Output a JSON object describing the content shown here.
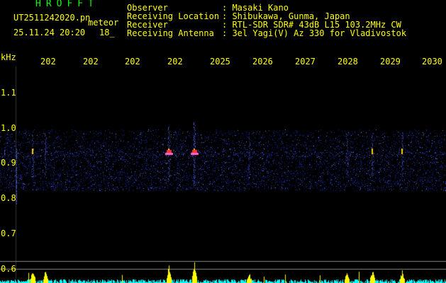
{
  "header": {
    "brand": "HROFFT",
    "filename": "UT2511242020.pn",
    "detector": "meteor",
    "datetime": "25.11.24 20:20",
    "detector_sub": "18_",
    "fields": [
      {
        "label": "Observer",
        "value": ": Masaki Kano"
      },
      {
        "label": "Receiving Location",
        "value": ": Shibukawa, Gunma, Japan"
      },
      {
        "label": "Receiver",
        "value": ": RTL-SDR SDR# 43dB L15 103.2MHz CW"
      },
      {
        "label": "Receiving Antenna",
        "value": ": 3el Yagi(V) Az 330 for Vladivostok"
      }
    ]
  },
  "axes": {
    "y_unit": "kHz",
    "y_ticks": [
      "1.1",
      "1.0",
      "0.9",
      "0.8",
      "0.7",
      "0.6"
    ],
    "x_ticks": [
      "202",
      "202",
      "202",
      "202",
      "2025",
      "2026",
      "2027",
      "2028",
      "2029",
      "2030"
    ]
  },
  "colors": {
    "text": "#ffff00",
    "brand": "#00ff00",
    "background": "#000000",
    "noise": "#2233cc",
    "signal_hot": "#ff3333",
    "signal_warm": "#ffcc00",
    "bottom_trace": "#00ffff"
  },
  "events": [
    {
      "at": 0.04,
      "strength": 0.6
    },
    {
      "at": 0.07,
      "strength": 0.5
    },
    {
      "at": 0.36,
      "strength": 0.8
    },
    {
      "at": 0.42,
      "strength": 1.0
    },
    {
      "at": 0.55,
      "strength": 0.35
    },
    {
      "at": 0.78,
      "strength": 0.45
    },
    {
      "at": 0.84,
      "strength": 0.55
    },
    {
      "at": 0.91,
      "strength": 0.55
    }
  ]
}
